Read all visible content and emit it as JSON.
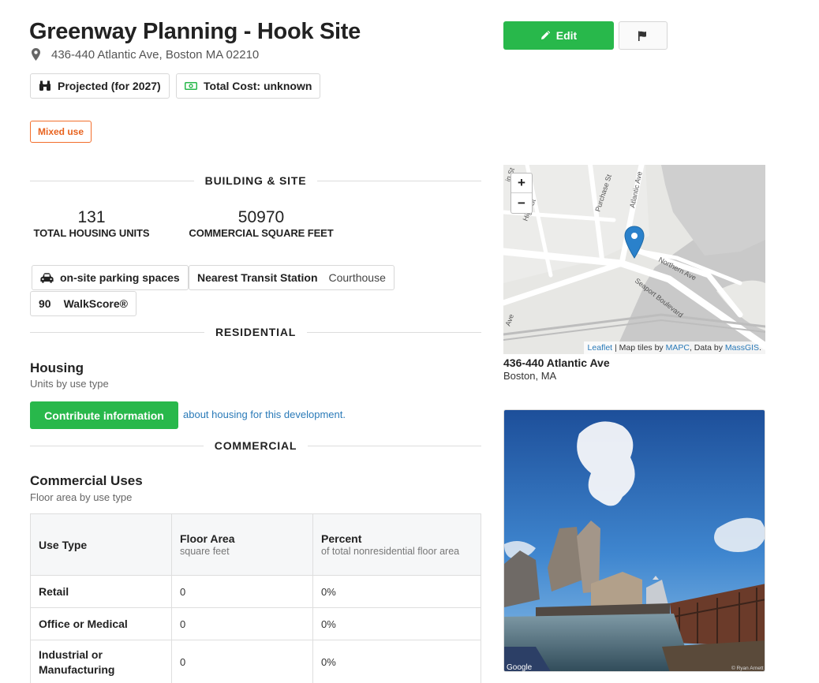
{
  "page": {
    "title": "Greenway Planning - Hook Site",
    "address": "436-440 Atlantic Ave, Boston MA 02210"
  },
  "chips": {
    "projected": "Projected (for 2027)",
    "total_cost": "Total Cost: unknown"
  },
  "tag": "Mixed use",
  "actions": {
    "edit_label": "Edit"
  },
  "building_site": {
    "heading": "BUILDING & SITE",
    "stats": [
      {
        "value": "131",
        "caption": "TOTAL HOUSING UNITS"
      },
      {
        "value": "50970",
        "caption": "COMMERCIAL SQUARE FEET"
      }
    ],
    "parking_label": "on-site parking spaces",
    "transit_label": "Nearest Transit Station",
    "transit_value": "Courthouse",
    "walkscore_value": "90",
    "walkscore_label": "WalkScore®"
  },
  "residential": {
    "heading": "RESIDENTIAL",
    "housing_title": "Housing",
    "housing_caption": "Units by use type",
    "contribute_label": "Contribute information",
    "contribute_link": "about housing for this development."
  },
  "commercial": {
    "heading": "COMMERCIAL",
    "title": "Commercial Uses",
    "caption": "Floor area by use type",
    "columns": [
      {
        "label": "Use Type",
        "sub": ""
      },
      {
        "label": "Floor Area",
        "sub": "square feet"
      },
      {
        "label": "Percent",
        "sub": "of total nonresidential floor area"
      }
    ],
    "rows": [
      {
        "type": "Retail",
        "area": "0",
        "percent": "0%"
      },
      {
        "type": "Office or Medical",
        "area": "0",
        "percent": "0%"
      },
      {
        "type": "Industrial or Manufacturing",
        "area": "0",
        "percent": "0%"
      }
    ]
  },
  "map": {
    "zoom_in": "+",
    "zoom_out": "−",
    "attrib_leaflet": "Leaflet",
    "attrib_mid": "| Map tiles by",
    "attrib_mapc": "MAPC",
    "attrib_data": ", Data by",
    "attrib_massgis": "MassGIS",
    "attrib_end": ".",
    "street_labels": [
      "Purchase St",
      "Atlantic Ave",
      "High St",
      "Northern Ave",
      "Seaport Boulevard",
      "Ave",
      "in St"
    ],
    "address_line1": "436-440 Atlantic Ave",
    "address_line2": "Boston, MA"
  },
  "photo": {
    "credit_left": "Google",
    "credit_right": "© Ryan Arnett"
  },
  "colors": {
    "accent_green": "#28b84b",
    "tag_orange": "#f26e2c",
    "link_blue": "#2a7ab8",
    "marker_blue": "#2a81cb"
  }
}
